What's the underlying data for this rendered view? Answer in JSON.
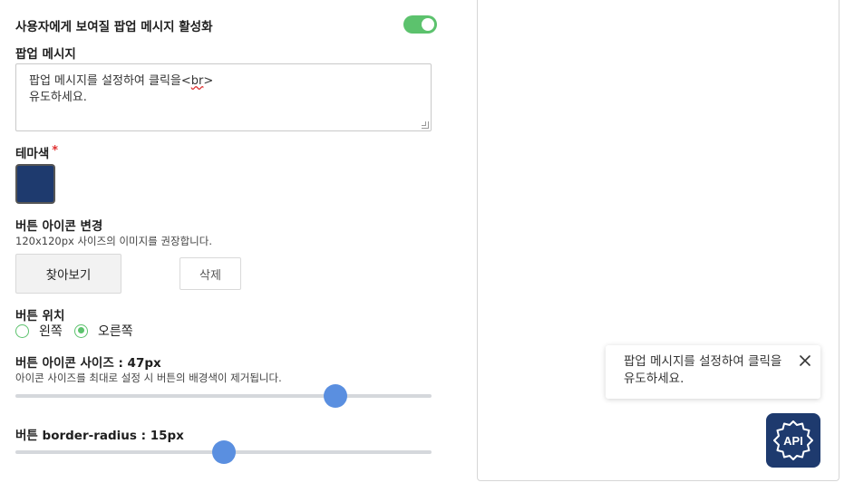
{
  "settings": {
    "popup_enable_label": "사용자에게 보여질 팝업 메시지 활성화",
    "popup_enable_on": true,
    "popup_message_label": "팝업 메시지",
    "popup_message_line1_pre": "팝업 메시지를 설정하여 클릭을<",
    "popup_message_line1_tag": "br",
    "popup_message_line1_post": ">",
    "popup_message_line2": "유도하세요.",
    "theme_color_label": "테마색",
    "required_mark": "*",
    "theme_color": "#1e3a6e",
    "icon_change_label": "버튼 아이콘 변경",
    "icon_change_hint": "120x120px 사이즈의 이미지를 권장합니다.",
    "browse_button": "찾아보기",
    "delete_button": "삭제",
    "position_label": "버튼 위치",
    "position_options": [
      "왼쪽",
      "오른쪽"
    ],
    "position_selected": "오른쪽",
    "icon_size_label": "버튼 아이콘 사이즈 : 47px",
    "icon_size_hint": "아이콘 사이즈를 최대로 설정 시 버튼의 배경색이 제거됩니다.",
    "icon_size_fraction": 0.77,
    "radius_label": "버튼 border-radius : 15px",
    "radius_fraction": 0.5
  },
  "preview": {
    "popup_line1": "팝업 메시지를 설정하여 클릭을",
    "popup_line2": "유도하세요.",
    "close_icon": "close-icon",
    "api_icon": "api-gear-icon",
    "api_text": "API",
    "accent": "#1e3a6e"
  },
  "colors": {
    "toggle_on": "#5cc26d",
    "slider_thumb": "#5a8fe0",
    "required": "#e03131"
  }
}
